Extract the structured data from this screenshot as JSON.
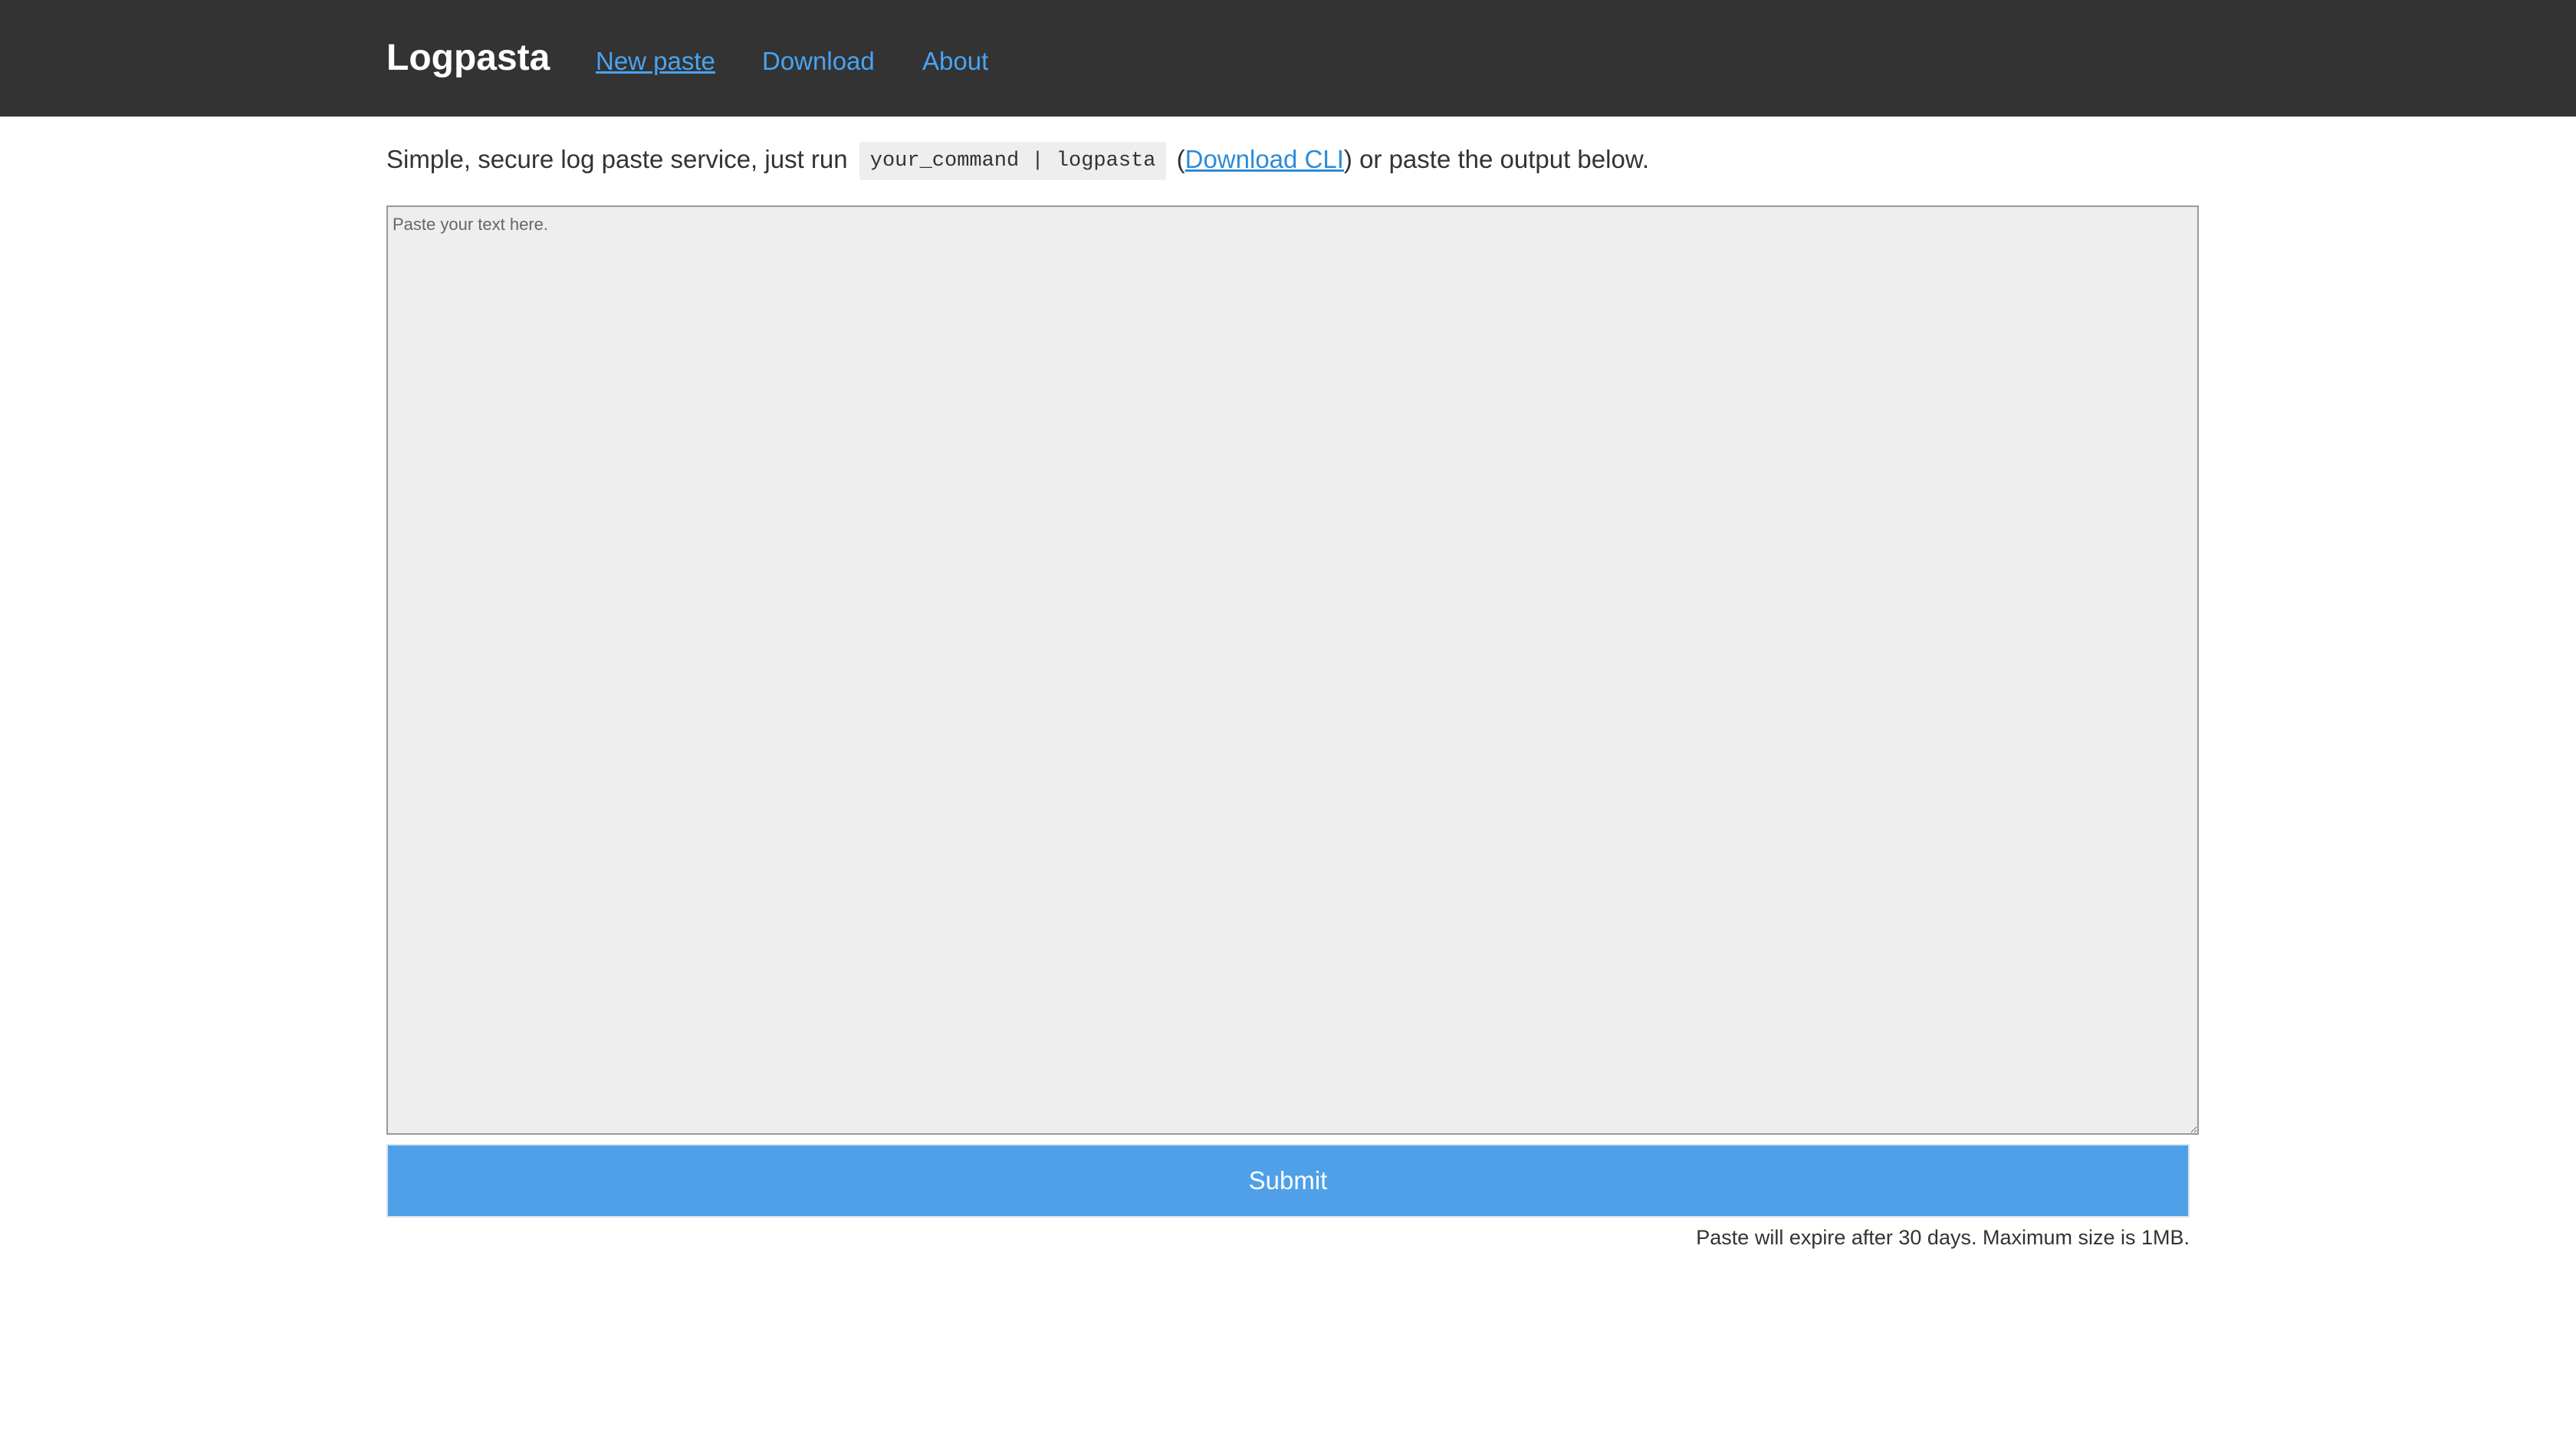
{
  "header": {
    "brand": "Logpasta",
    "nav": [
      {
        "label": "New paste",
        "active": true
      },
      {
        "label": "Download",
        "active": false
      },
      {
        "label": "About",
        "active": false
      }
    ]
  },
  "intro": {
    "prefix": "Simple, secure log paste service, just run",
    "command": "your_command | logpasta",
    "open_paren": "(",
    "cli_link": "Download CLI",
    "suffix": ") or paste the output below."
  },
  "paste": {
    "placeholder": "Paste your text here.",
    "value": ""
  },
  "submit_label": "Submit",
  "footnote": "Paste will expire after 30 days. Maximum size is 1MB.",
  "colors": {
    "navbar": "#333333",
    "link": "#4aa3f0",
    "submit": "#4fa0e8"
  }
}
